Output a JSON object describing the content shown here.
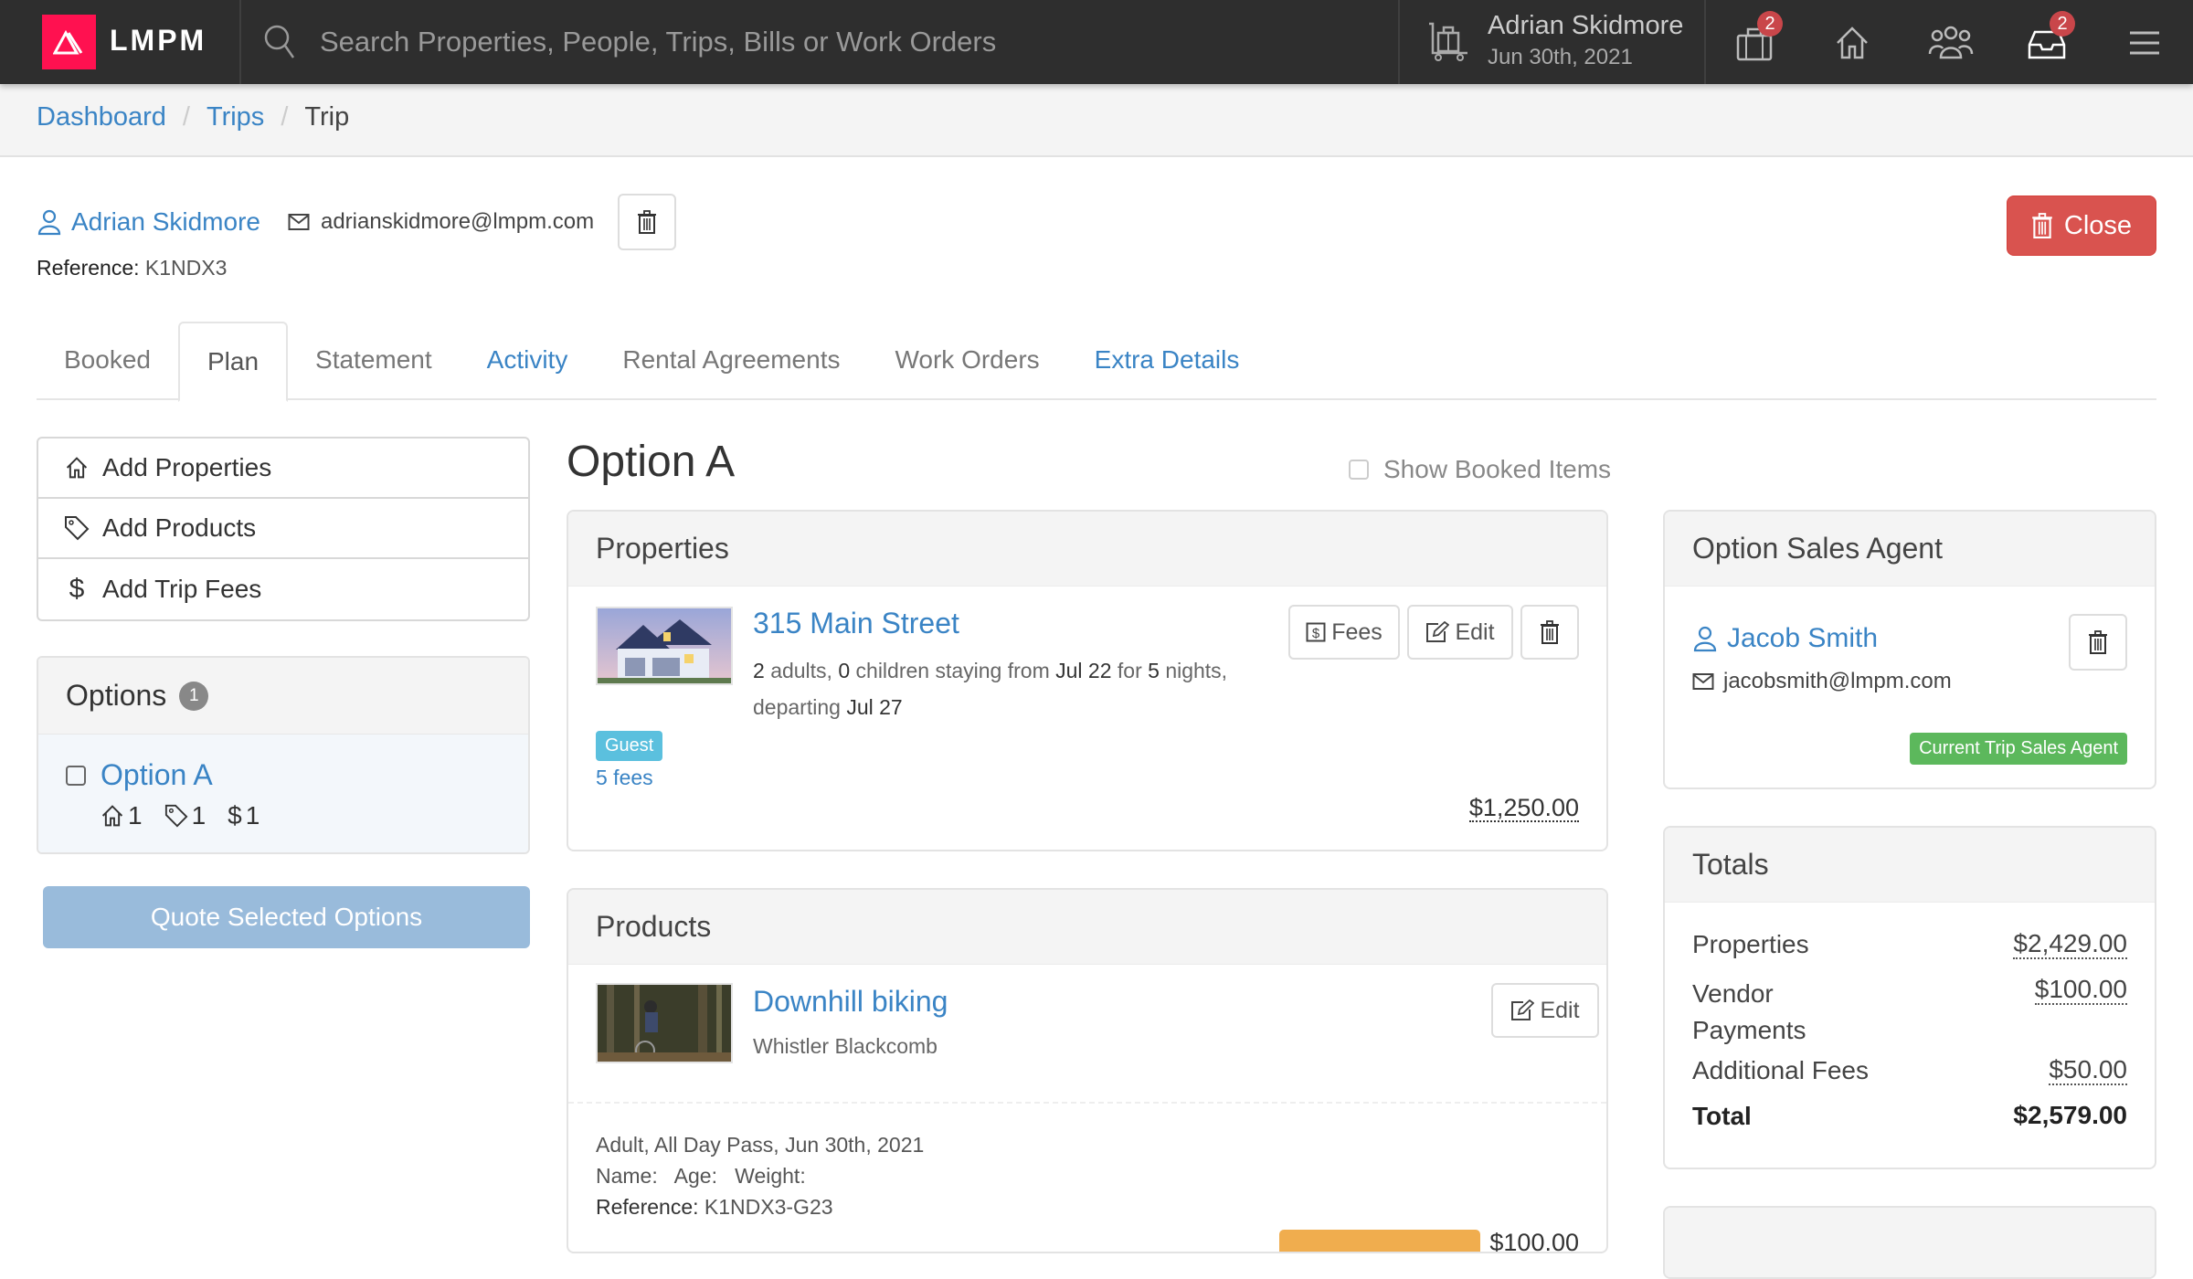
{
  "header": {
    "logo_text": "LMPM",
    "search_placeholder": "Search Properties, People, Trips, Bills or Work Orders",
    "user": {
      "name": "Adrian Skidmore",
      "date": "Jun 30th, 2021",
      "icon": "luggage-cart-icon"
    },
    "icons": [
      {
        "name": "suitcase-icon",
        "badge": "2"
      },
      {
        "name": "home-icon",
        "badge": null
      },
      {
        "name": "users-icon",
        "badge": null
      },
      {
        "name": "inbox-icon",
        "badge": "2"
      },
      {
        "name": "menu-icon",
        "badge": null
      }
    ],
    "brand_color": "#ff1150",
    "badge_color": "#c9464a"
  },
  "breadcrumb": {
    "items": [
      {
        "label": "Dashboard",
        "link": true
      },
      {
        "label": "Trips",
        "link": true
      },
      {
        "label": "Trip",
        "link": false
      }
    ],
    "separator": "/"
  },
  "guest": {
    "name": "Adrian Skidmore",
    "email": "adrianskidmore@lmpm.com",
    "reference_label": "Reference:",
    "reference_value": "K1NDX3"
  },
  "close_button": {
    "label": "Close",
    "color": "#d9534f"
  },
  "tabs": [
    {
      "label": "Booked",
      "active": false,
      "style": "gray"
    },
    {
      "label": "Plan",
      "active": true,
      "style": "gray"
    },
    {
      "label": "Statement",
      "active": false,
      "style": "gray"
    },
    {
      "label": "Activity",
      "active": false,
      "style": "blue"
    },
    {
      "label": "Rental Agreements",
      "active": false,
      "style": "gray"
    },
    {
      "label": "Work Orders",
      "active": false,
      "style": "gray"
    },
    {
      "label": "Extra Details",
      "active": false,
      "style": "blue"
    }
  ],
  "sidebar": {
    "actions": [
      {
        "label": "Add Properties",
        "icon": "home-icon"
      },
      {
        "label": "Add Products",
        "icon": "tag-icon"
      },
      {
        "label": "Add Trip Fees",
        "icon": "dollar-icon"
      }
    ],
    "options": {
      "title": "Options",
      "count": "1",
      "items": [
        {
          "label": "Option A",
          "checked": false,
          "properties": "1",
          "products": "1",
          "fees": "1"
        }
      ]
    },
    "quote_button": "Quote Selected Options"
  },
  "main": {
    "option_title": "Option A",
    "show_booked_label": "Show Booked Items",
    "show_booked_checked": false,
    "properties_card": {
      "title": "Properties",
      "items": [
        {
          "title": "315 Main Street",
          "adults": "2",
          "children": "0",
          "arrive": "Jul 22",
          "nights": "5",
          "depart": "Jul 27",
          "text_adults": "adults,",
          "text_children": "children staying from",
          "text_for": "for",
          "text_nights": "nights,",
          "text_departing": "departing",
          "badge": "Guest",
          "fees_link": "5 fees",
          "price": "$1,250.00",
          "buttons": {
            "fees": "Fees",
            "edit": "Edit"
          }
        }
      ]
    },
    "products_card": {
      "title": "Products",
      "items": [
        {
          "title": "Downhill biking",
          "vendor": "Whistler Blackcomb",
          "edit": "Edit",
          "detail_line": "Adult, All Day Pass, Jun 30th, 2021",
          "name_label": "Name:",
          "age_label": "Age:",
          "weight_label": "Weight:",
          "reference_label": "Reference:",
          "reference_value": "K1NDX3-G23",
          "price": "$100.00"
        }
      ]
    }
  },
  "right": {
    "agent_card": {
      "title": "Option Sales Agent",
      "name": "Jacob Smith",
      "email": "jacobsmith@lmpm.com",
      "badge": "Current Trip Sales Agent"
    },
    "totals_card": {
      "title": "Totals",
      "rows": [
        {
          "label": "Properties",
          "amount": "$2,429.00"
        },
        {
          "label": "Vendor Payments",
          "amount": "$100.00"
        },
        {
          "label": "Additional Fees",
          "amount": "$50.00"
        }
      ],
      "total_label": "Total",
      "total_amount": "$2,579.00"
    }
  }
}
